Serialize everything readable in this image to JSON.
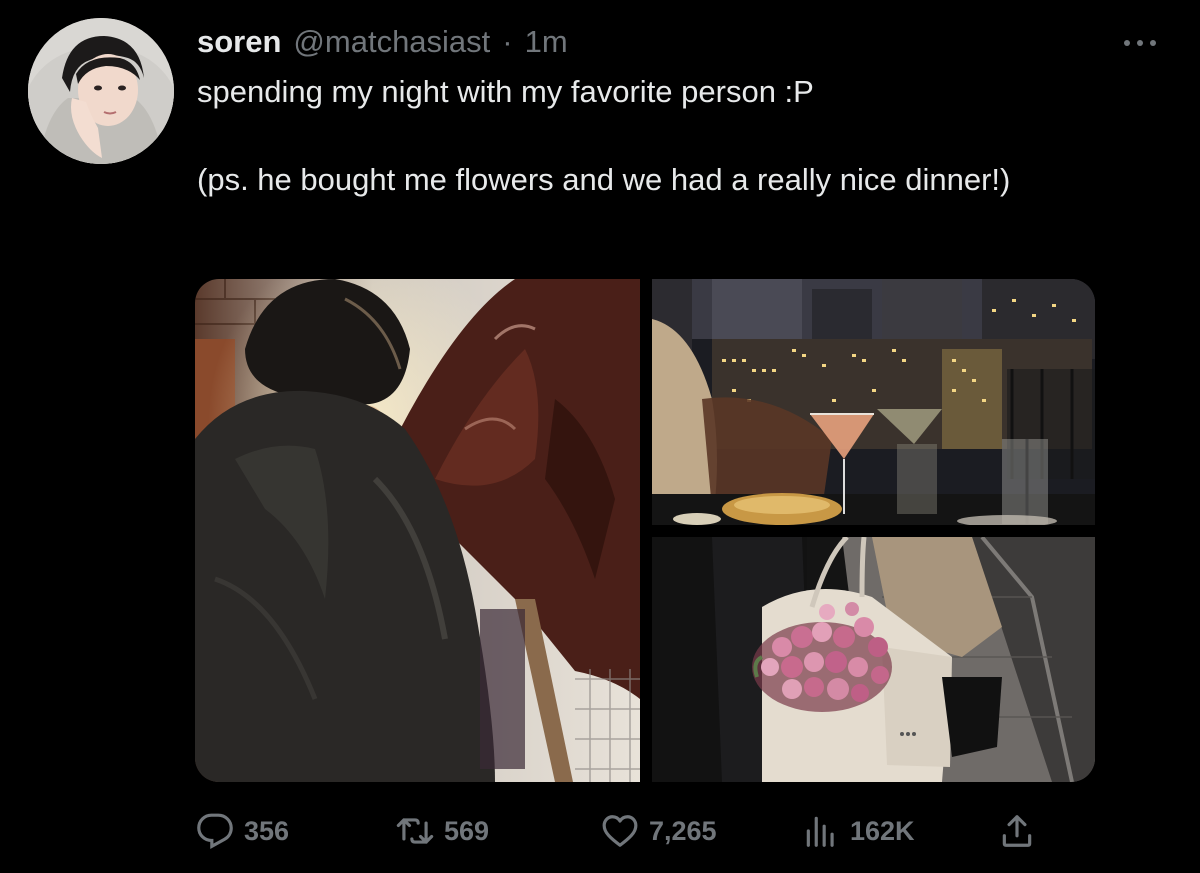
{
  "tweet": {
    "display_name": "soren",
    "handle": "@matchasiast",
    "separator": "·",
    "time": "1m",
    "text_line1": "spending my night with my favorite person :P",
    "text_line2": "(ps. he bought me flowers and we had a really nice dinner!)"
  },
  "actions": {
    "replies": "356",
    "retweets": "569",
    "likes": "7,265",
    "views": "162K"
  },
  "icons": {
    "more": "more-dots-icon",
    "reply": "reply-bubble-icon",
    "retweet": "retweet-icon",
    "like": "heart-icon",
    "views": "views-bar-chart-icon",
    "share": "share-upload-icon"
  },
  "colors": {
    "background": "#000000",
    "text_primary": "#e7e9ea",
    "text_secondary": "#71767b"
  }
}
